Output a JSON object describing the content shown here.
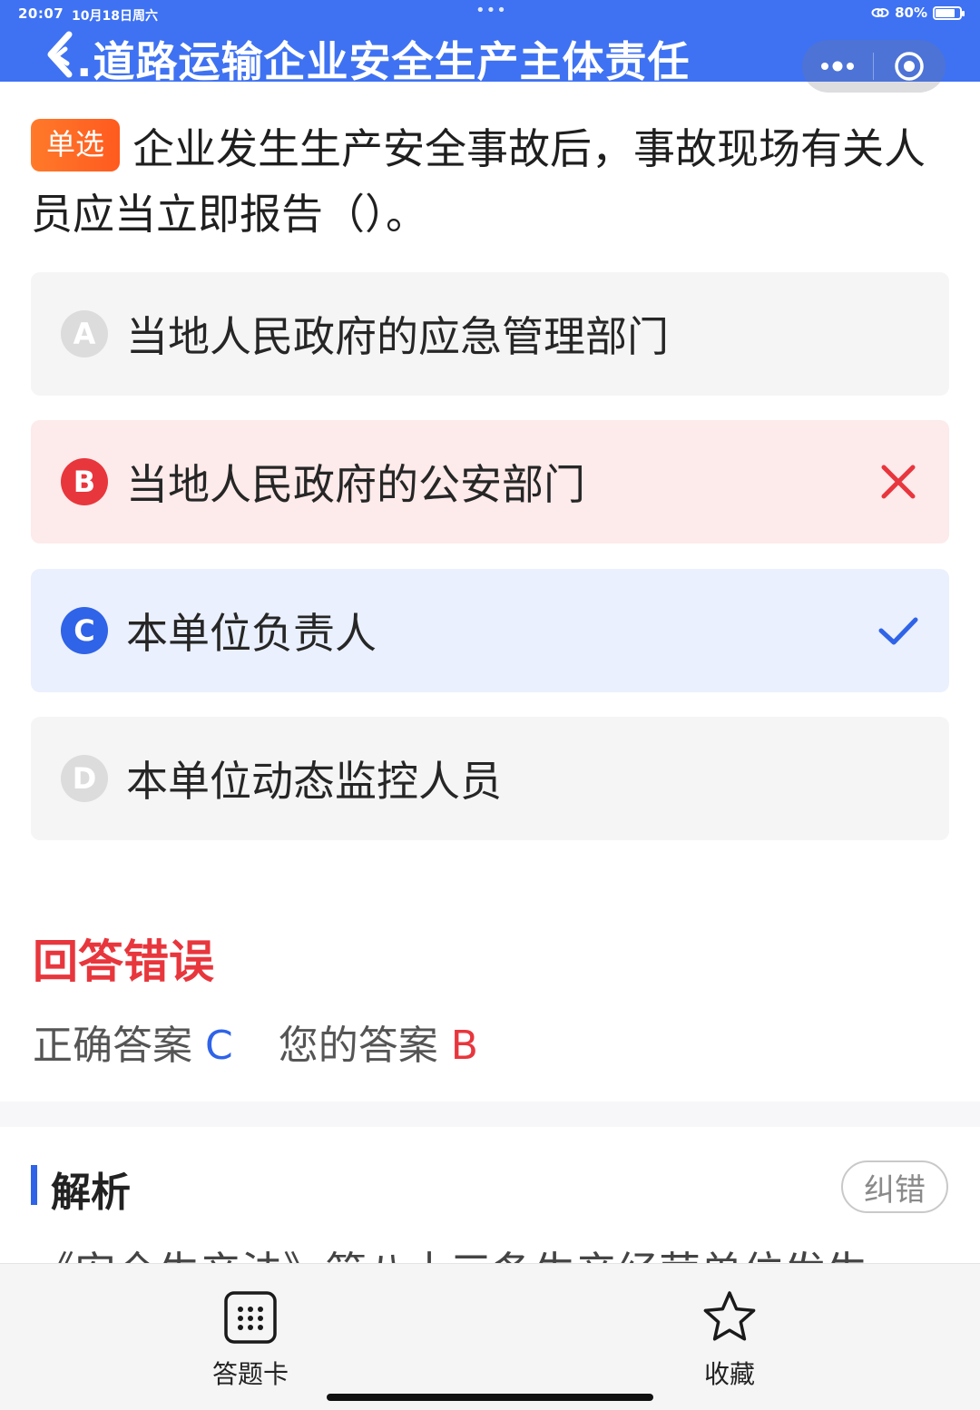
{
  "status_bar": {
    "time": "20:07",
    "date": "10月18日周六",
    "dots": "•••",
    "battery": "80%",
    "battery_level": 0.8
  },
  "header": {
    "title": ".道路运输企业安全生产主体责任",
    "bg_color": "#3f72f2"
  },
  "question": {
    "type_badge": "单选",
    "text": "企业发生生产安全事故后，事故现场有关人员应当立即报告（）。"
  },
  "options": [
    {
      "letter": "A",
      "text": "当地人民政府的应急管理部门",
      "state": "normal"
    },
    {
      "letter": "B",
      "text": "当地人民政府的公安部门",
      "state": "wrong",
      "mark_icon": "cross-icon"
    },
    {
      "letter": "C",
      "text": "本单位负责人",
      "state": "correct",
      "mark_icon": "check-icon"
    },
    {
      "letter": "D",
      "text": "本单位动态监控人员",
      "state": "normal"
    }
  ],
  "result": {
    "title": "回答错误",
    "correct_label": "正确答案",
    "correct_value": "C",
    "mine_label": "您的答案",
    "mine_value": "B"
  },
  "analysis": {
    "title": "解析",
    "report_button": "纠错",
    "text_preview": "《安全生产法》第八十三条生产经营单位发生"
  },
  "bottom_bar": {
    "card_label": "答题卡",
    "card_icon": "grid-icon",
    "fav_label": "收藏",
    "fav_icon": "star-icon"
  },
  "colors": {
    "wrong": "#e8363d",
    "correct": "#2f63e8",
    "badge": "#ff6a26"
  }
}
